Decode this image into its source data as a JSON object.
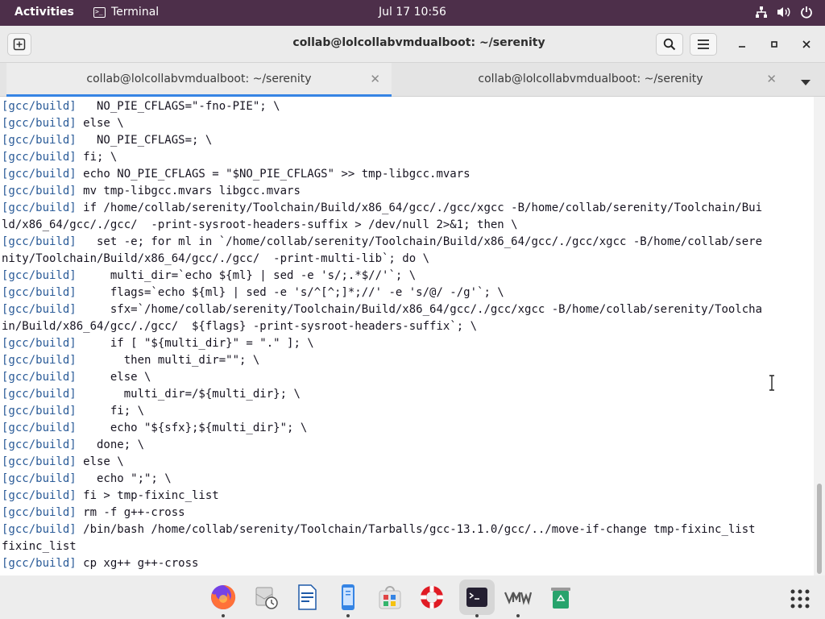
{
  "topbar": {
    "activities": "Activities",
    "app_name": "Terminal",
    "clock": "Jul 17  10:56",
    "tray_icons": [
      "network-icon",
      "volume-icon",
      "power-icon"
    ]
  },
  "window": {
    "title": "collab@lolcollabvmdualboot: ~/serenity",
    "buttons": [
      "new-tab",
      "search",
      "menu",
      "minimize",
      "maximize",
      "close"
    ]
  },
  "tabs": [
    {
      "label": "collab@lolcollabvmdualboot: ~/serenity",
      "active": true
    },
    {
      "label": "collab@lolcollabvmdualboot: ~/serenity",
      "active": false
    }
  ],
  "terminal": {
    "lines": [
      {
        "prompt": "[gcc/build]",
        "text": "   NO_PIE_CFLAGS=\"-fno-PIE\"; \\"
      },
      {
        "prompt": "[gcc/build]",
        "text": " else \\"
      },
      {
        "prompt": "[gcc/build]",
        "text": "   NO_PIE_CFLAGS=; \\"
      },
      {
        "prompt": "[gcc/build]",
        "text": " fi; \\"
      },
      {
        "prompt": "[gcc/build]",
        "text": " echo NO_PIE_CFLAGS = \"$NO_PIE_CFLAGS\" >> tmp-libgcc.mvars"
      },
      {
        "prompt": "[gcc/build]",
        "text": " mv tmp-libgcc.mvars libgcc.mvars"
      },
      {
        "prompt": "[gcc/build]",
        "text": " if /home/collab/serenity/Toolchain/Build/x86_64/gcc/./gcc/xgcc -B/home/collab/serenity/Toolchain/Bui"
      },
      {
        "prompt": "",
        "text": "ld/x86_64/gcc/./gcc/  -print-sysroot-headers-suffix > /dev/null 2>&1; then \\"
      },
      {
        "prompt": "[gcc/build]",
        "text": "   set -e; for ml in `/home/collab/serenity/Toolchain/Build/x86_64/gcc/./gcc/xgcc -B/home/collab/sere"
      },
      {
        "prompt": "",
        "text": "nity/Toolchain/Build/x86_64/gcc/./gcc/  -print-multi-lib`; do \\"
      },
      {
        "prompt": "[gcc/build]",
        "text": "     multi_dir=`echo ${ml} | sed -e 's/;.*$//'`; \\"
      },
      {
        "prompt": "[gcc/build]",
        "text": "     flags=`echo ${ml} | sed -e 's/^[^;]*;//' -e 's/@/ -/g'`; \\"
      },
      {
        "prompt": "[gcc/build]",
        "text": "     sfx=`/home/collab/serenity/Toolchain/Build/x86_64/gcc/./gcc/xgcc -B/home/collab/serenity/Toolcha"
      },
      {
        "prompt": "",
        "text": "in/Build/x86_64/gcc/./gcc/  ${flags} -print-sysroot-headers-suffix`; \\"
      },
      {
        "prompt": "[gcc/build]",
        "text": "     if [ \"${multi_dir}\" = \".\" ]; \\"
      },
      {
        "prompt": "[gcc/build]",
        "text": "       then multi_dir=\"\"; \\"
      },
      {
        "prompt": "[gcc/build]",
        "text": "     else \\"
      },
      {
        "prompt": "[gcc/build]",
        "text": "       multi_dir=/${multi_dir}; \\"
      },
      {
        "prompt": "[gcc/build]",
        "text": "     fi; \\"
      },
      {
        "prompt": "[gcc/build]",
        "text": "     echo \"${sfx};${multi_dir}\"; \\"
      },
      {
        "prompt": "[gcc/build]",
        "text": "   done; \\"
      },
      {
        "prompt": "[gcc/build]",
        "text": " else \\"
      },
      {
        "prompt": "[gcc/build]",
        "text": "   echo \";\"; \\"
      },
      {
        "prompt": "[gcc/build]",
        "text": " fi > tmp-fixinc_list"
      },
      {
        "prompt": "[gcc/build]",
        "text": " rm -f g++-cross"
      },
      {
        "prompt": "[gcc/build]",
        "text": " /bin/bash /home/collab/serenity/Toolchain/Tarballs/gcc-13.1.0/gcc/../move-if-change tmp-fixinc_list"
      },
      {
        "prompt": "",
        "text": "fixinc_list"
      },
      {
        "prompt": "[gcc/build]",
        "text": " cp xg++ g++-cross"
      }
    ],
    "prompt_color": "#2a5b98",
    "text_color": "#171421",
    "background": "#ffffff"
  },
  "dock": {
    "items": [
      {
        "name": "firefox-icon",
        "running": true
      },
      {
        "name": "mail-clock-icon",
        "running": false
      },
      {
        "name": "writer-document-icon",
        "running": false
      },
      {
        "name": "phone-icon",
        "running": true
      },
      {
        "name": "software-store-icon",
        "running": false
      },
      {
        "name": "help-lifebuoy-icon",
        "running": false
      },
      {
        "name": "terminal-icon",
        "running": true
      },
      {
        "name": "vmware-icon",
        "running": true
      },
      {
        "name": "trash-icon",
        "running": false
      }
    ],
    "app_grid": "show-applications-icon"
  },
  "colors": {
    "topbar": "#4d2f4a",
    "accent": "#3584e4"
  }
}
